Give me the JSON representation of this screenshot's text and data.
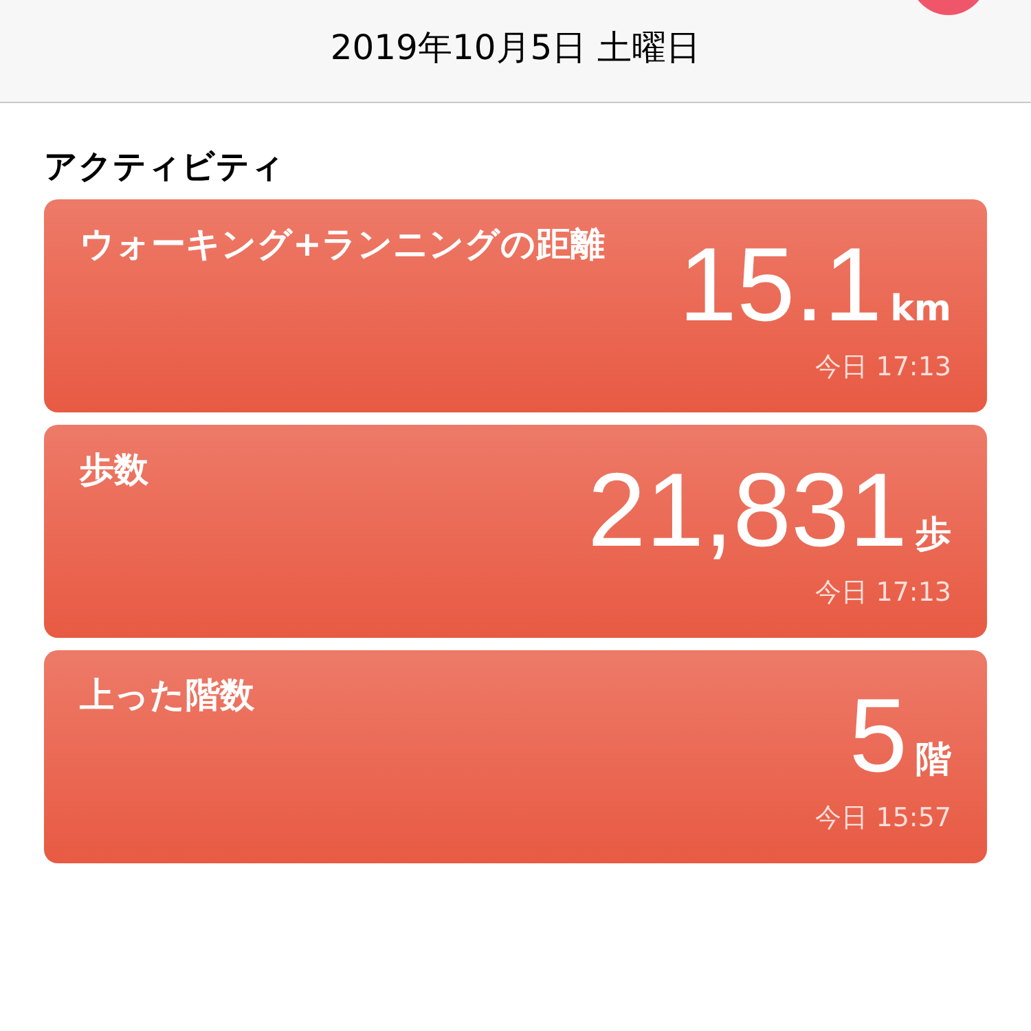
{
  "header": {
    "date": "2019年10月5日 土曜日"
  },
  "section_title": "アクティビティ",
  "cards": [
    {
      "title": "ウォーキング+ランニングの距離",
      "value": "15.1",
      "unit": "km",
      "time": "今日 17:13"
    },
    {
      "title": "歩数",
      "value": "21,831",
      "unit": "歩",
      "time": "今日 17:13"
    },
    {
      "title": "上った階数",
      "value": "5",
      "unit": "階",
      "time": "今日 15:57"
    }
  ]
}
